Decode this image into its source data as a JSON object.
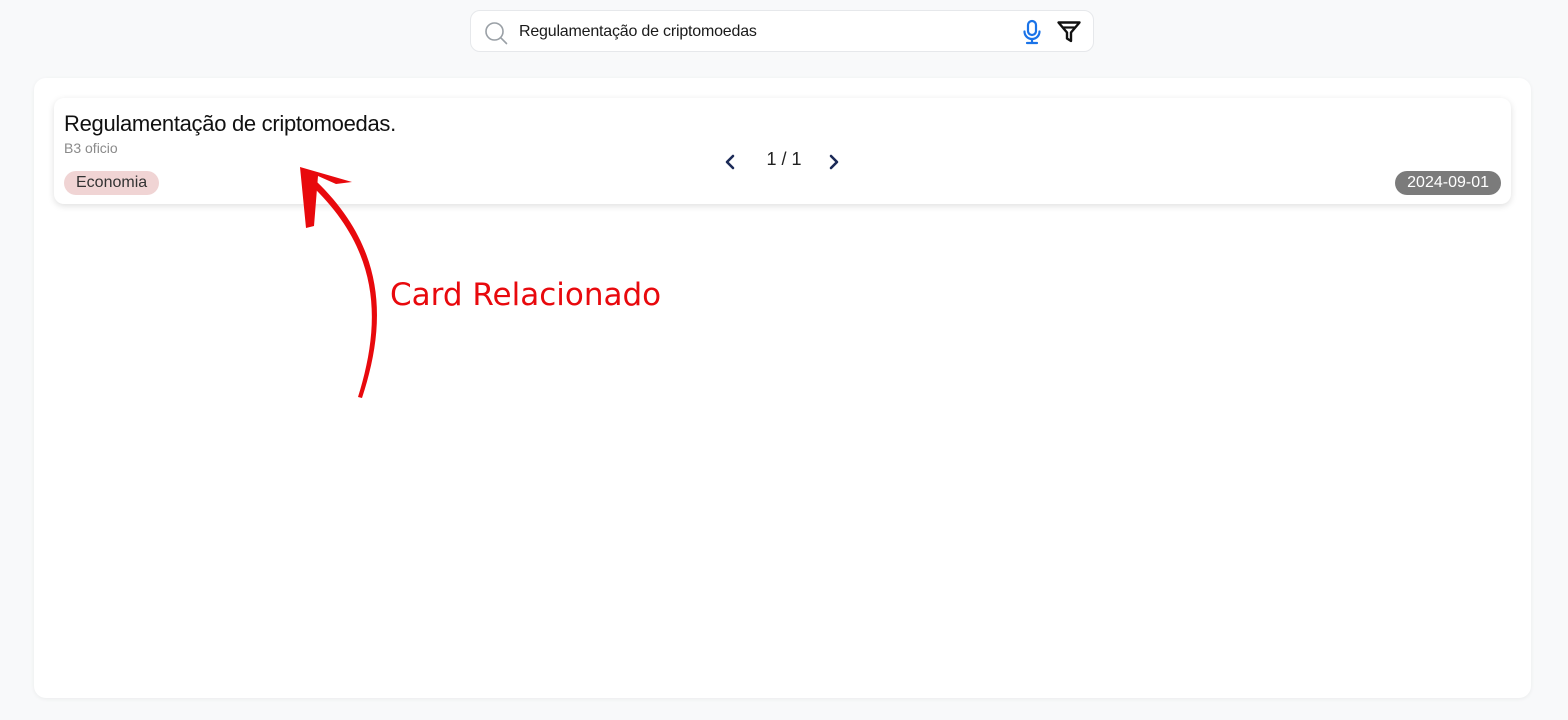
{
  "search": {
    "value": "Regulamentação de criptomoedas",
    "icons": {
      "search": "search-icon",
      "mic": "mic-icon",
      "filter": "filter-icon"
    }
  },
  "results": [
    {
      "title": "Regulamentação de criptomoedas.",
      "source": "B3 oficio",
      "category": "Economia",
      "date": "2024-09-01"
    }
  ],
  "pagination": {
    "indicator": "1 / 1",
    "prev_icon": "chevron-left-icon",
    "next_icon": "chevron-right-icon"
  },
  "annotation": {
    "label": "Card Relacionado",
    "color": "#e8090d"
  },
  "colors": {
    "accent_blue": "#1a73e8",
    "nav_blue": "#1b2a57",
    "tag_bg": "#f0d4d4",
    "date_bg": "#7b7b7b"
  }
}
